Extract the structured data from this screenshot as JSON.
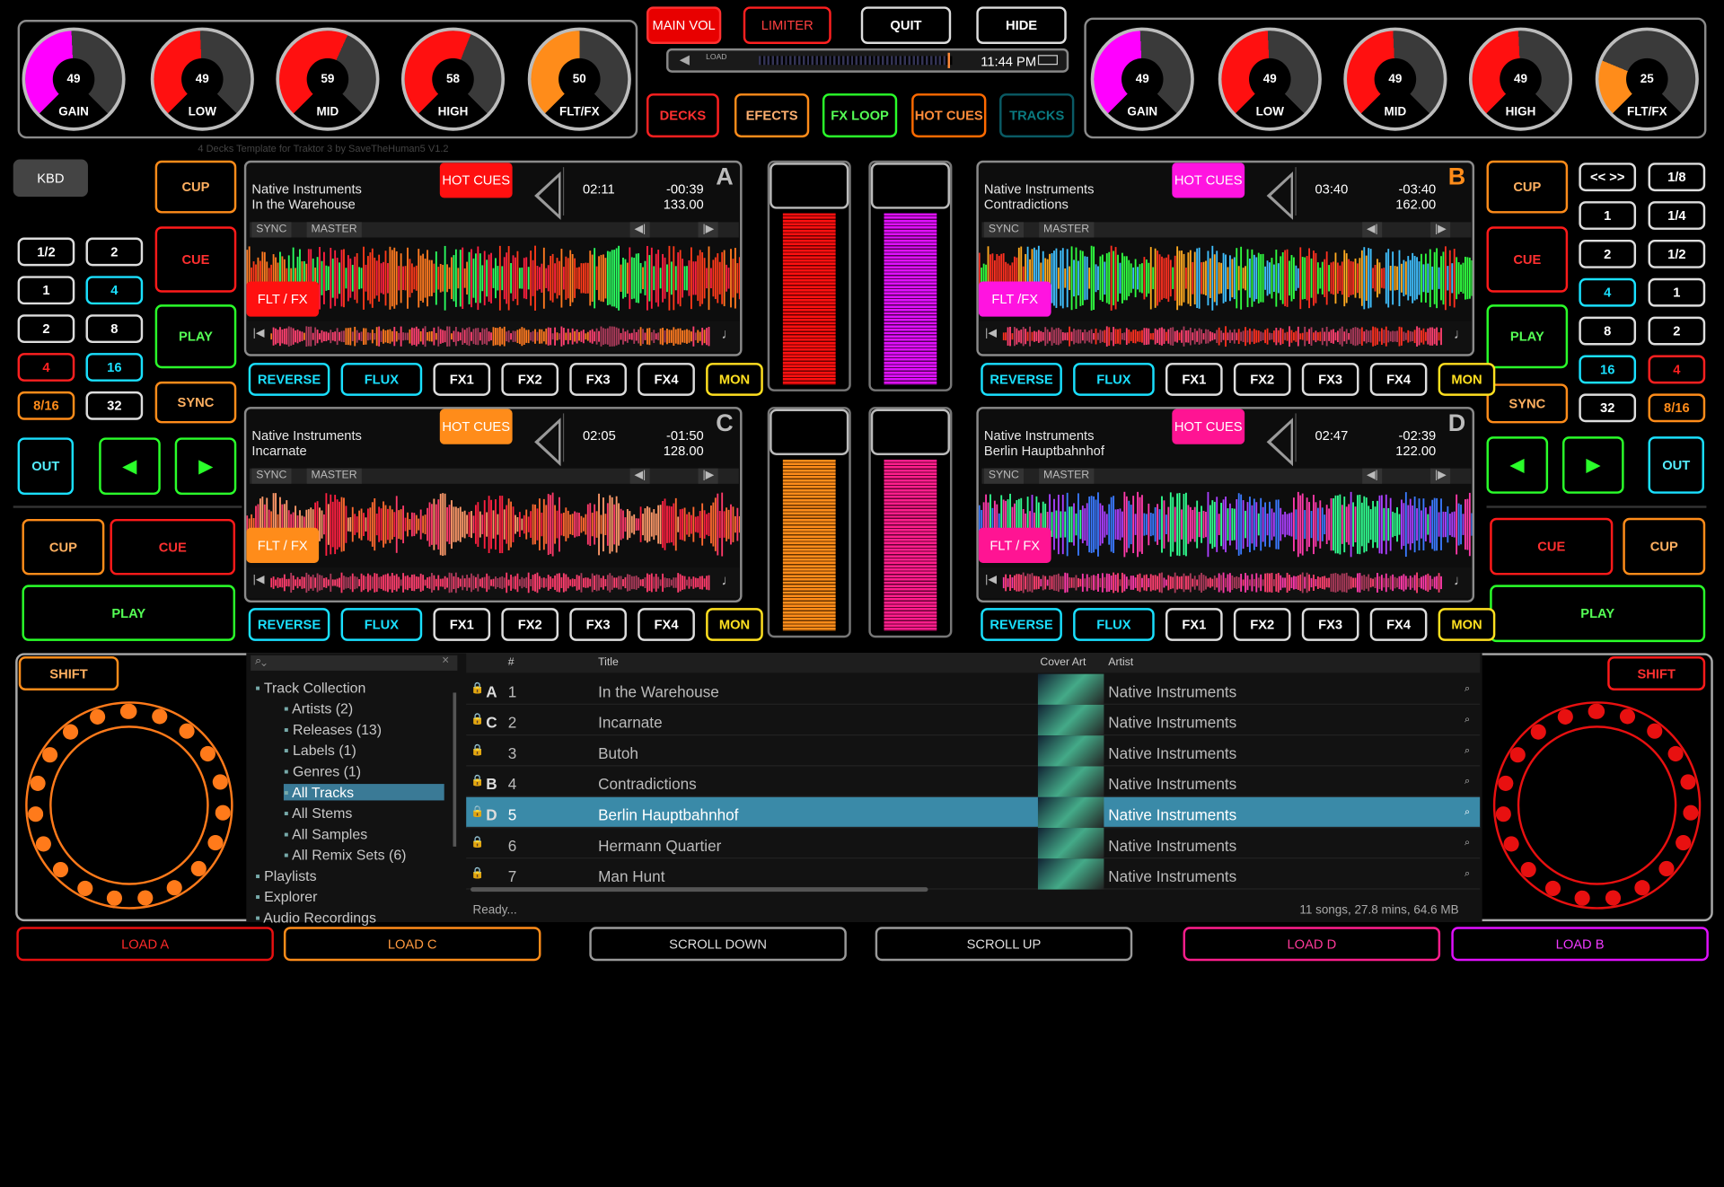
{
  "master": {
    "main_vol": "MAIN VOL",
    "limiter": "LIMITER",
    "quit": "QUIT",
    "hide": "HIDE",
    "load": "LOAD",
    "time": "11:44 PM",
    "decks": "DECKS",
    "effects": "EFECTS",
    "fx_loop": "FX LOOP",
    "hot_cues": "HOT CUES",
    "tracks": "TRACKS",
    "template": "4 Decks Template for Traktor 3 by SaveTheHuman5 V1.2"
  },
  "knobs_left": [
    {
      "value": "49",
      "label": "GAIN",
      "color": "#ff00ff"
    },
    {
      "value": "49",
      "label": "LOW",
      "color": "#ff1010"
    },
    {
      "value": "59",
      "label": "MID",
      "color": "#ff1010"
    },
    {
      "value": "58",
      "label": "HIGH",
      "color": "#ff1010"
    },
    {
      "value": "50",
      "label": "FLT/FX",
      "color": "#ff8c1a"
    }
  ],
  "knobs_right": [
    {
      "value": "49",
      "label": "GAIN",
      "color": "#ff00ff"
    },
    {
      "value": "49",
      "label": "LOW",
      "color": "#ff1010"
    },
    {
      "value": "49",
      "label": "MID",
      "color": "#ff1010"
    },
    {
      "value": "49",
      "label": "HIGH",
      "color": "#ff1010"
    },
    {
      "value": "25",
      "label": "FLT/FX",
      "color": "#ff8c1a"
    }
  ],
  "decks": [
    {
      "letter": "A",
      "artist": "Native Instruments",
      "title": "In the Warehouse",
      "elapsed": "02:11",
      "remain": "-00:39",
      "bpm": "133.00",
      "hotcue": "HOT CUES",
      "hotcue_color": "#ff1010",
      "fltfx": "FLT / FX",
      "fltfx_color": "#ff1010"
    },
    {
      "letter": "B",
      "artist": "Native Instruments",
      "title": "Contradictions",
      "elapsed": "03:40",
      "remain": "-03:40",
      "bpm": "162.00",
      "hotcue": "HOT CUES",
      "hotcue_color": "#ff14e0",
      "fltfx": "FLT /FX",
      "fltfx_color": "#ff14e0"
    },
    {
      "letter": "C",
      "artist": "Native Instruments",
      "title": "Incarnate",
      "elapsed": "02:05",
      "remain": "-01:50",
      "bpm": "128.00",
      "hotcue": "HOT CUES",
      "hotcue_color": "#ff8c1a",
      "fltfx": "FLT / FX",
      "fltfx_color": "#ff8c1a"
    },
    {
      "letter": "D",
      "artist": "Native Instruments",
      "title": "Berlin Hauptbahnhof",
      "elapsed": "02:47",
      "remain": "-02:39",
      "bpm": "122.00",
      "hotcue": "HOT CUES",
      "hotcue_color": "#ff1493",
      "fltfx": "FLT / FX",
      "fltfx_color": "#ff1493"
    }
  ],
  "deck_labels": {
    "sync": "SYNC",
    "master": "MASTER"
  },
  "fx_row": [
    "REVERSE",
    "FLUX",
    "FX1",
    "FX2",
    "FX3",
    "FX4",
    "MON"
  ],
  "left_col": {
    "kbd": "KBD",
    "cup": "CUP",
    "cue": "CUE",
    "play": "PLAY",
    "sync": "SYNC",
    "out": "OUT",
    "loops": [
      "1/2",
      "2",
      "1",
      "4",
      "2",
      "8",
      "4",
      "16",
      "8/16",
      "32"
    ],
    "cup2": "CUP",
    "cue2": "CUE",
    "play2": "PLAY",
    "shift": "SHIFT"
  },
  "right_col": {
    "cup": "CUP",
    "cue": "CUE",
    "play": "PLAY",
    "sync": "SYNC",
    "out": "OUT",
    "nav": "<< >>",
    "loops_a": [
      "1",
      "2",
      "4",
      "8",
      "16",
      "32"
    ],
    "loops_b": [
      "1/8",
      "1/4",
      "1/2",
      "1",
      "2",
      "4",
      "8/16"
    ],
    "cue2": "CUE",
    "cup2": "CUP",
    "play2": "PLAY",
    "shift": "SHIFT"
  },
  "browser": {
    "search_placeholder": "⌕⌄",
    "tree": [
      "Track Collection",
      "Artists (2)",
      "Releases (13)",
      "Labels (1)",
      "Genres (1)",
      "All Tracks",
      "All Stems",
      "All Samples",
      "All Remix Sets (6)",
      "Playlists",
      "Explorer",
      "Audio Recordings"
    ],
    "headers": {
      "num": "#",
      "title": "Title",
      "cover": "Cover Art",
      "artist": "Artist"
    },
    "rows": [
      {
        "deck": "A",
        "num": "1",
        "title": "In  the Warehouse",
        "artist": "Native Instruments"
      },
      {
        "deck": "C",
        "num": "2",
        "title": "Incarnate",
        "artist": "Native Instruments"
      },
      {
        "deck": "",
        "num": "3",
        "title": "Butoh",
        "artist": "Native Instruments"
      },
      {
        "deck": "B",
        "num": "4",
        "title": "Contradictions",
        "artist": "Native Instruments"
      },
      {
        "deck": "D",
        "num": "5",
        "title": "Berlin Hauptbahnhof",
        "artist": "Native Instruments"
      },
      {
        "deck": "",
        "num": "6",
        "title": "Hermann Quartier",
        "artist": "Native Instruments"
      },
      {
        "deck": "",
        "num": "7",
        "title": "Man Hunt",
        "artist": "Native Instruments"
      }
    ],
    "status": "Ready...",
    "summary": "11 songs, 27.8 mins, 64.6 MB"
  },
  "bottom": {
    "load_a": "LOAD A",
    "load_c": "LOAD C",
    "scroll_down": "SCROLL DOWN",
    "scroll_up": "SCROLL UP",
    "load_d": "LOAD D",
    "load_b": "LOAD B"
  }
}
